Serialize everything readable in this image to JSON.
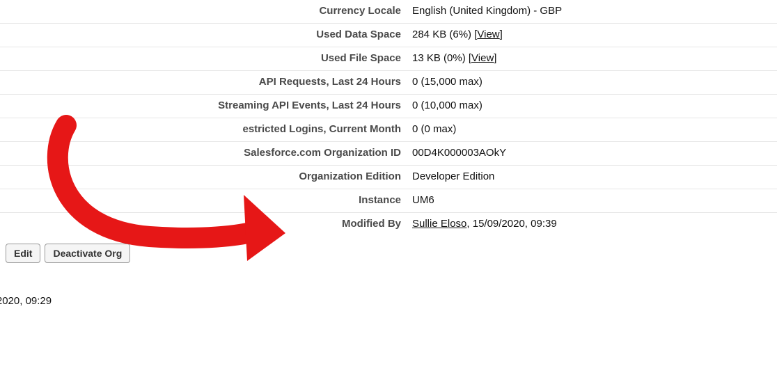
{
  "rows": {
    "currency_locale": {
      "label": "Currency Locale",
      "value": "English (United Kingdom) - GBP"
    },
    "used_data_space": {
      "label": "Used Data Space",
      "prefix": "284 KB (6%) [",
      "link": "View",
      "suffix": "]"
    },
    "used_file_space": {
      "label": "Used File Space",
      "prefix": "13 KB (0%) [",
      "link": "View",
      "suffix": "]"
    },
    "api_requests": {
      "label": "API Requests, Last 24 Hours",
      "value": "0 (15,000 max)"
    },
    "streaming_api": {
      "label": "Streaming API Events, Last 24 Hours",
      "value": "0 (10,000 max)"
    },
    "restricted": {
      "label": "estricted Logins, Current Month",
      "value": "0 (0 max)"
    },
    "org_id": {
      "label": "Salesforce.com Organization ID",
      "value": "00D4K000003AOkY"
    },
    "org_edition": {
      "label": "Organization Edition",
      "value": "Developer Edition"
    },
    "instance": {
      "label": "Instance",
      "value": "UM6"
    },
    "modified_by": {
      "label": "Modified By",
      "name": "Sullie Eloso",
      "rest": ", 15/09/2020, 09:39"
    }
  },
  "left_fragment": "'2020, 09:29",
  "buttons": {
    "edit": "Edit",
    "deactivate": "Deactivate Org"
  }
}
